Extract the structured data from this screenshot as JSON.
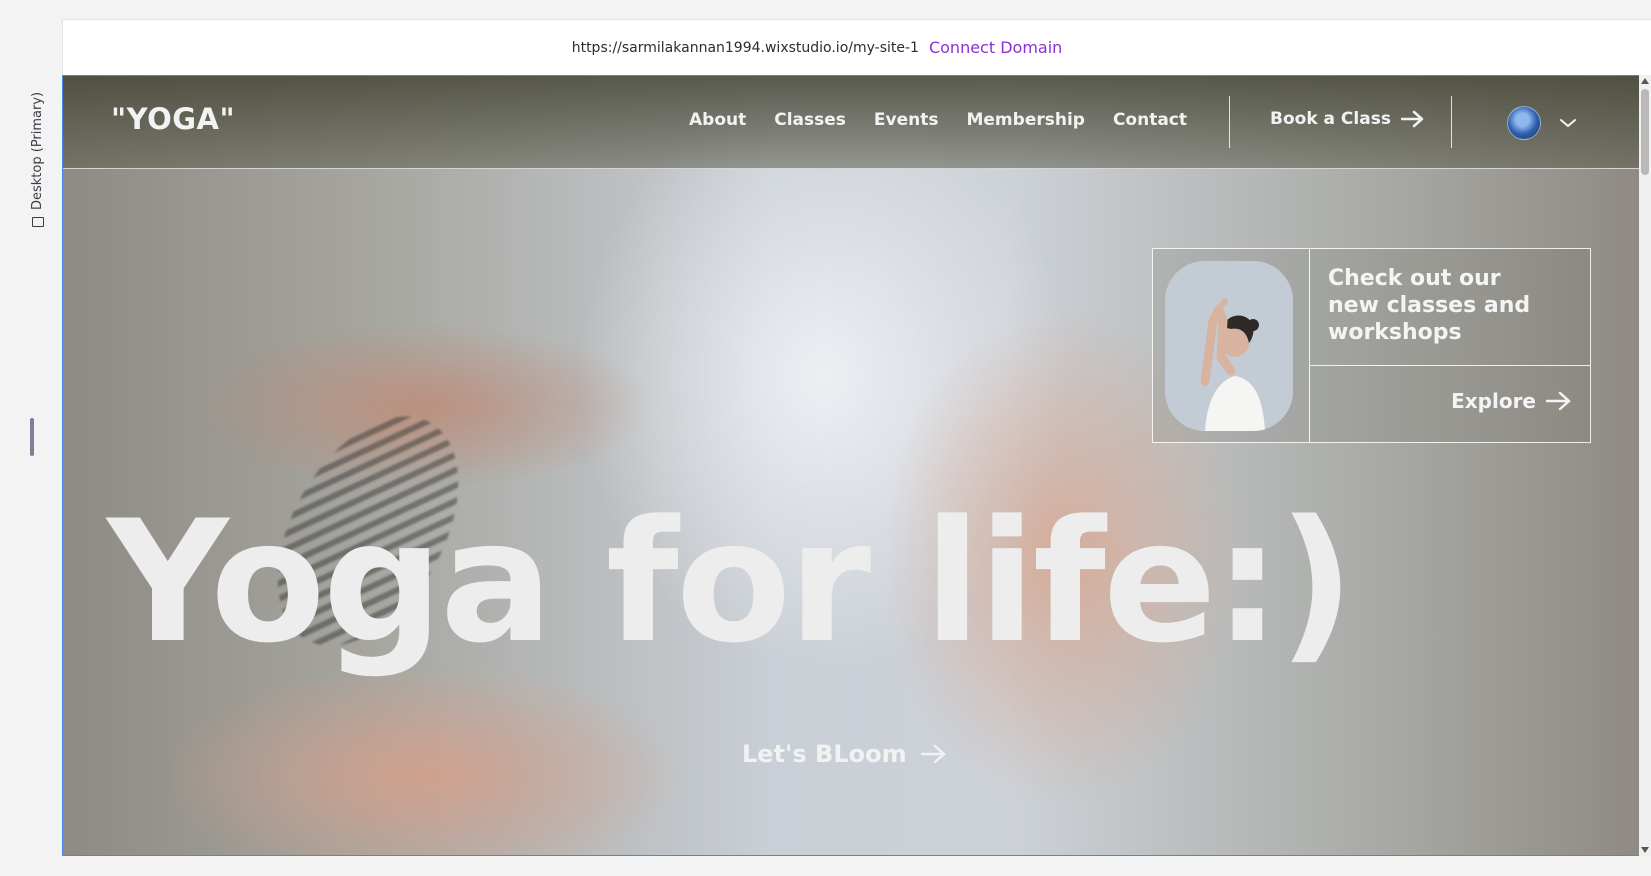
{
  "editor": {
    "device_label": "Desktop (Primary)",
    "site_url": "https://sarmilakannan1994.wixstudio.io/my-site-1",
    "connect_domain_label": "Connect Domain"
  },
  "site": {
    "logo": "\"YOGA\"",
    "nav": [
      "About",
      "Classes",
      "Events",
      "Membership",
      "Contact"
    ],
    "book_label": "Book a Class",
    "promo": {
      "heading": "Check out our new classes and workshops",
      "explore_label": "Explore"
    },
    "headline": "Yoga for life:)",
    "cta_label": "Let's BLoom"
  },
  "colors": {
    "accent_link": "#8d2fd6",
    "selection_border": "#4a86e8",
    "hero_text": "#ededed"
  },
  "icons": {
    "arrow": "arrow-right-icon",
    "chevron": "chevron-down-icon",
    "device": "desktop-icon"
  }
}
